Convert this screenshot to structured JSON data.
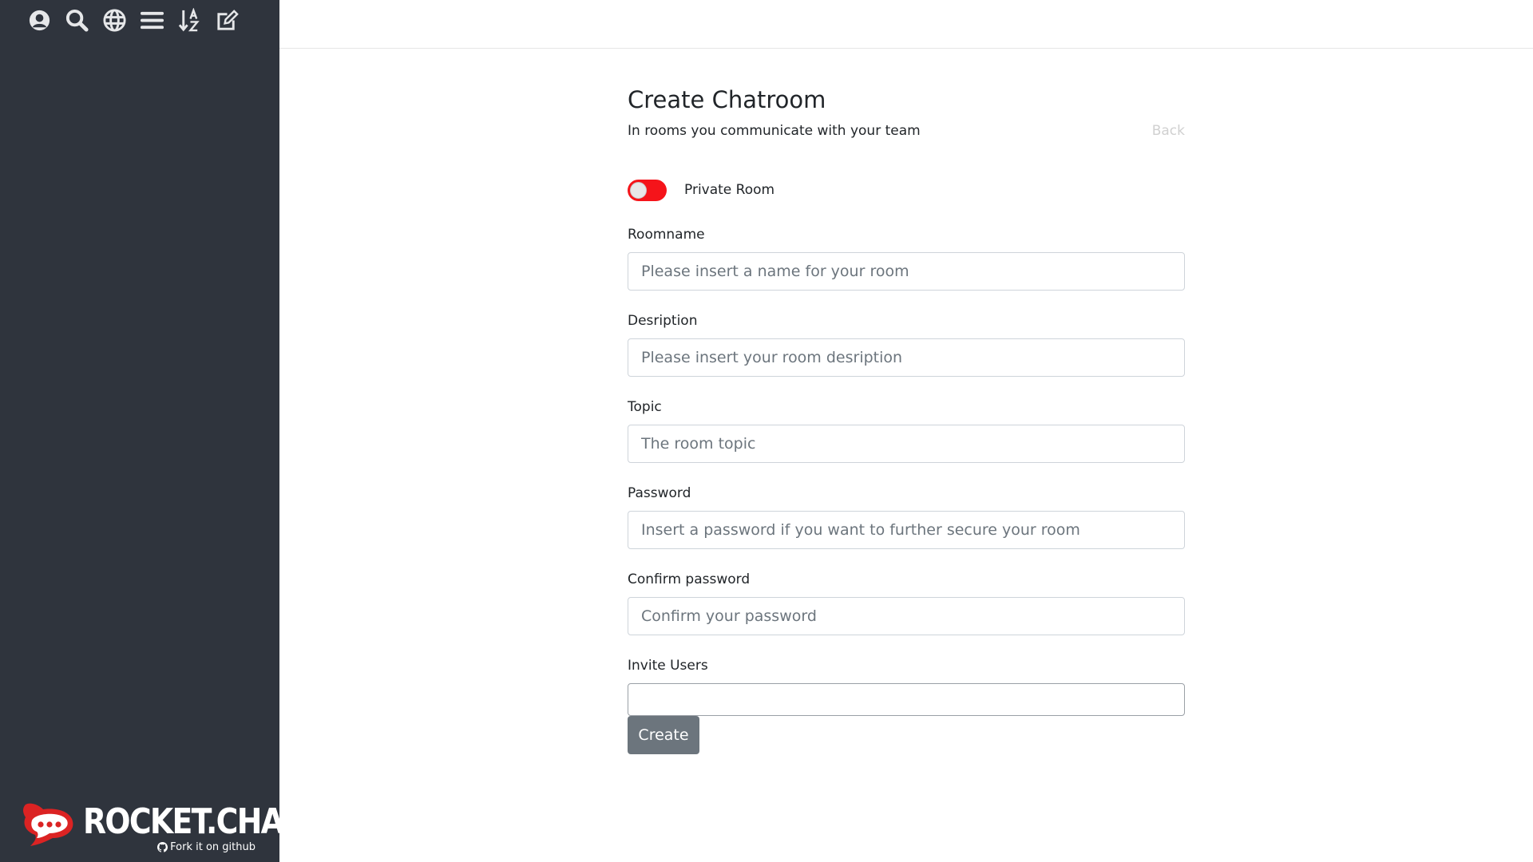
{
  "sidebar": {
    "toolbar": [
      {
        "icon": "user-circle-icon",
        "name": "account-button"
      },
      {
        "icon": "search-icon",
        "name": "search-button"
      },
      {
        "icon": "globe-icon",
        "name": "directory-button"
      },
      {
        "icon": "list-icon",
        "name": "display-mode-button"
      },
      {
        "icon": "sort-alpha-icon",
        "name": "sort-button"
      },
      {
        "icon": "edit-icon",
        "name": "create-new-button"
      }
    ],
    "brand": {
      "logo_text": "ROCKET.CHAT",
      "fork_link": "Fork it on github"
    }
  },
  "main": {
    "title": "Create Chatroom",
    "subtitle": "In rooms you communicate with your team",
    "back_label": "Back",
    "private_toggle": {
      "label": "Private Room",
      "on": false
    },
    "fields": {
      "roomname": {
        "label": "Roomname",
        "placeholder": "Please insert a name for your room",
        "value": ""
      },
      "description": {
        "label": "Desription",
        "placeholder": "Please insert your room desription",
        "value": ""
      },
      "topic": {
        "label": "Topic",
        "placeholder": "The room topic",
        "value": ""
      },
      "password": {
        "label": "Password",
        "placeholder": "Insert a password if you want to further secure your room",
        "value": ""
      },
      "confirm_password": {
        "label": "Confirm password",
        "placeholder": "Confirm your password",
        "value": ""
      },
      "invite_users": {
        "label": "Invite Users",
        "placeholder": "",
        "value": ""
      }
    },
    "create_label": "Create"
  },
  "colors": {
    "sidebar_bg": "#2f343d",
    "toggle_red": "#f5141a",
    "button_gray": "#6c757d"
  }
}
